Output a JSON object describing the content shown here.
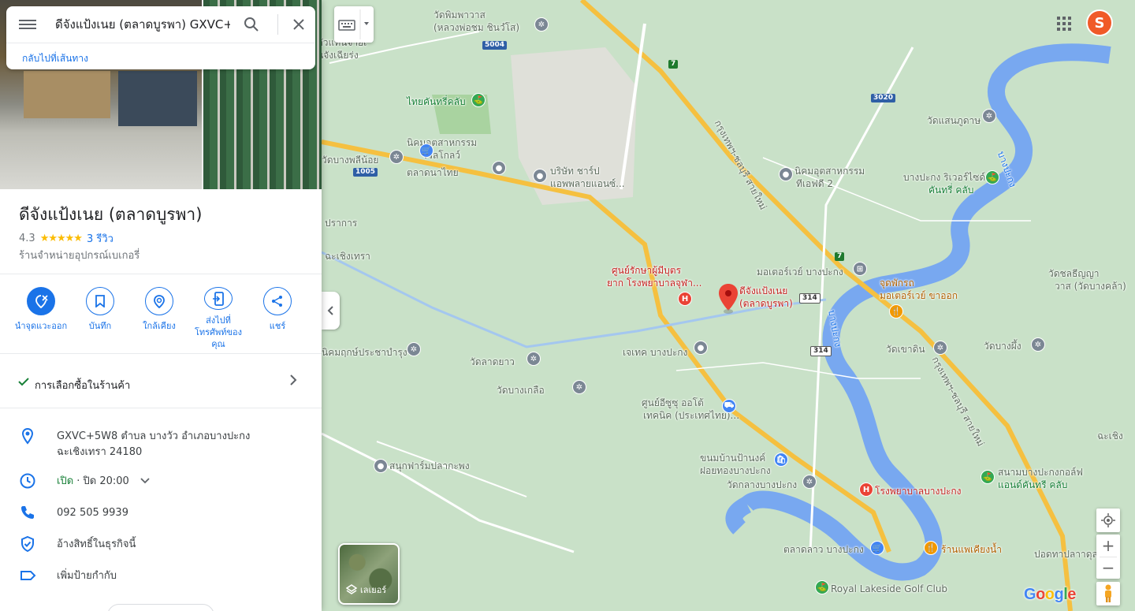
{
  "search": {
    "query": "ดีจังแป้งเนย (ตลาดบูรพา) GXVC+5W8",
    "back_link": "กลับไปที่เส้นทาง"
  },
  "place": {
    "title": "ดีจังแป้งเนย (ตลาดบูรพา)",
    "rating": "4.3",
    "stars": "★★★★★",
    "rating_fraction": 0.86,
    "reviews": "3 รีวิว",
    "category": "ร้านจำหน่ายอุปกรณ์เบเกอรี่"
  },
  "actions": [
    {
      "label": "นำจุดแวะออก",
      "icon": "remove-stop-icon"
    },
    {
      "label": "บันทึก",
      "icon": "bookmark-icon"
    },
    {
      "label": "ใกล้เคียง",
      "icon": "nearby-icon"
    },
    {
      "label": "ส่งไปที่โทรศัพท์ของคุณ",
      "icon": "send-to-phone-icon"
    },
    {
      "label": "แชร์",
      "icon": "share-icon"
    }
  ],
  "shopping": {
    "label": "การเลือกซื้อในร้านค้า"
  },
  "info": {
    "address": "GXVC+5W8 ตำบล บางวัว อำเภอบางปะกง ฉะเชิงเทรา 24180",
    "hours_open": "เปิด",
    "hours_close": " · ปิด 20:00",
    "phone": "092 505 9939",
    "claim": "อ้างสิทธิ์ในธุรกิจนี้",
    "label": "เพิ่มป้ายกำกับ"
  },
  "map": {
    "layer_label": "เลเยอร์",
    "google": [
      "G",
      "o",
      "o",
      "g",
      "l",
      "e"
    ],
    "labels": {
      "wat_phimphawat": "วัดพิมพาวาส",
      "luangpho": "(หลวงพ่อชม ชินวํโส)",
      "thai_country_club": "ไทยคันทรี่คลับ",
      "nikhom_wellgrow": "นิคมอุตสาหกรรม",
      "wellgrow": "เวลโกลว์",
      "wat_bangphli_noi": "วัดบางพลีน้อย",
      "talat_na_thai": "ตลาดนาไทย",
      "company_sharp": "บริษัท ชาร์ป",
      "appliances": "แอพพลายแอนซ์...",
      "wat_saen_phudat": "วัดแสนภูดาษ",
      "nikhom_tfd": "นิคมอุตสาหกรรม",
      "tfd2": "ทีเอฟดี 2",
      "bangpakong_riverside": "บางปะกง ริเวอร์ไซด์",
      "country_club": "คันทรี่ คลับ",
      "wat_sothon": "วัดชลธีญญา",
      "wat_bangkhla": "วาส (วัดบางคล้า)",
      "motorway_bangpakong": "มอเตอร์เวย์ บางปะกง",
      "rest_area": "จุดพักรถ",
      "motorway_out": "มอเตอร์เวย์ ขาออก",
      "hospital_center": "ศูนย์รักษาผู้มีบุตร",
      "hospital_center2": "ยาก โรงพยาบาลจุฬา...",
      "store_name": "ดีจังแป้งเนย",
      "store_name2": "(ตลาดบูรพา)",
      "wat_khao_din": "วัดเขาดิน",
      "wat_bang_phueng": "วัดบางผึ้ง",
      "jaytech": "เจเทค บางปะกง",
      "nikhom_prachachamrung": "นิคมฤกษ์ประชาบำรุง",
      "wat_lat_yao": "วัดลาดยาว",
      "wat_bang_kluea": "วัดบางเกลือ",
      "isuzu": "ศูนย์อีซูซุ ออโต้",
      "isuzu2": "เทคนิค (ประเทศไทย)...",
      "kanom": "ขนมบ้านป้านงค์",
      "foi_thong": "ฝอยทองบางปะกง",
      "wat_klang": "วัดกลางบางปะกง",
      "hospital_bangpakong": "โรงพยาบาลบางปะกง",
      "sanuk_farm": "สนุกฟาร์มปลากะพง",
      "golf_field": "สนามบางปะกงกอล์ฟ",
      "lotus_country": "แอนด์คันทรี คลับ",
      "talat_lao": "ตลาดลาว บางปะกง",
      "restaurant": "ร้านแพเคียงน้ำ",
      "royal_lakeside": "Royal Lakeside Golf Club",
      "road_bangna": "กรุงเทพฯ-ชลบุรี สายใหม่",
      "road_bangna2": "กรุงเทพฯ-ชลบุรี สายใหม่",
      "bangpakong_river": "บางปะกง",
      "bangpakong_river2": "บางปะกง",
      "chachoengsao": "ฉะเชิงเทรา",
      "chachoengsao_right": "ฉะเชิง",
      "samut_prakan": "ปราการ",
      "tai_left": "ตัวแทนจ่ายเ",
      "tai_left2": "นจังเฉียร่ง",
      "sino_bridge": "ปอดทาปลาาดุล",
      "shield_5004": "5004",
      "shield_3020": "3020",
      "shield_1005": "1005",
      "shield_7a": "7",
      "shield_7b": "7",
      "shield_314a": "314",
      "shield_314b": "314"
    },
    "colors": {
      "land": "#c9e1c8",
      "water": "#78a8f0",
      "highway": "#f5c040",
      "road": "#ffffff",
      "marker": "#ea4335"
    }
  }
}
